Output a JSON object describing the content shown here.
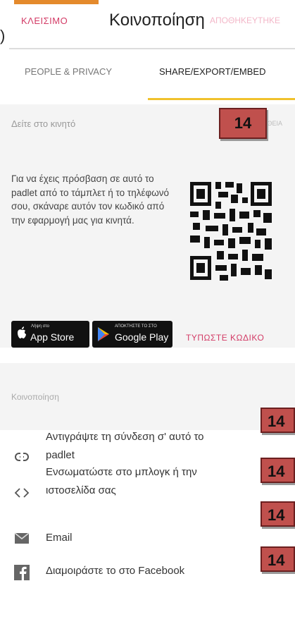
{
  "header": {
    "close_label": "ΚΛΕΙΣΙΜΟ",
    "title": "Κοινοποίηση",
    "save_label": "ΑΠΟΘΗΚΕΥΤΗΚΕ",
    "stray_char": ")"
  },
  "tabs": {
    "people_privacy": "PEOPLE & PRIVACY",
    "share_export_embed": "SHARE/EXPORT/EMBED"
  },
  "mobile": {
    "heading": "Δείτε στο κινητό",
    "help_label": "ΒΟΗΘΕΙΑ",
    "description": "Για να έχεις πρόσβαση σε αυτό το padlet από το τάμπλετ ή το τηλέφωνό σου, σκάναρε αυτόν τον κωδικό από την εφαρμογή μας για κινητά.",
    "app_store_small": "Λήψη στο",
    "app_store_big": "App Store",
    "google_play_small": "ΑΠΟΚΤΗΣΤΕ ΤΟ ΣΤΟ",
    "google_play_big": "Google Play",
    "type_code_label": "ΤΥΠΩΣΤΕ ΚΩΔΙΚΟ"
  },
  "share": {
    "heading": "Κοινοποίηση",
    "items": [
      {
        "label_line1": "Αντιγράψτε τη σύνδεση σ' αυτό το",
        "label_line2": "padlet",
        "icon": "link-icon"
      },
      {
        "label_line1": "Ενσωματώστε στο μπλογκ ή την",
        "label_line2": "ιστοσελίδα σας",
        "icon": "embed-code-icon"
      },
      {
        "label_line1": "Email",
        "label_line2": "",
        "icon": "envelope-icon"
      },
      {
        "label_line1": "Διαμοιράστε το στο Facebook",
        "label_line2": "",
        "icon": "facebook-icon"
      }
    ]
  },
  "badges": {
    "main": "14",
    "copy_link": "14",
    "embed": "14",
    "email": "14",
    "facebook": "14"
  },
  "colors": {
    "accent_pink": "#d33b66",
    "tab_underline": "#f0c12c",
    "badge_fill": "#c0504d",
    "section_bg": "#f4f4f4"
  }
}
